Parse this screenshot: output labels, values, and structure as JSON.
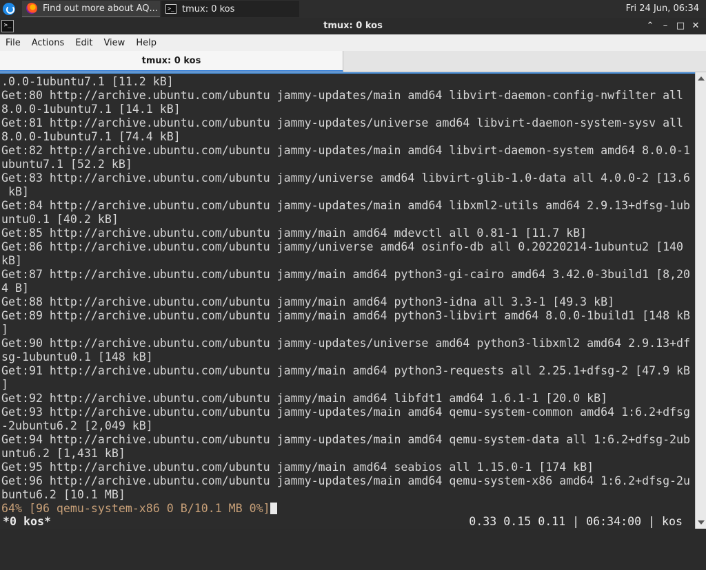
{
  "taskbar": {
    "tasks": [
      {
        "label": "Find out more about AQ...",
        "icon": "firefox-icon"
      },
      {
        "label": "tmux: 0 kos",
        "icon": "terminal-icon"
      }
    ],
    "clock": "Fri 24 Jun, 06:34"
  },
  "window": {
    "title": "tmux: 0 kos",
    "buttons": {
      "keep_above": "⌃",
      "minimize": "–",
      "maximize": "□",
      "close": "✕"
    }
  },
  "menubar": {
    "items": [
      "File",
      "Actions",
      "Edit",
      "View",
      "Help"
    ]
  },
  "tabs": [
    {
      "label": "tmux: 0 kos",
      "active": true
    }
  ],
  "terminal": {
    "lines": [
      ".0.0-1ubuntu7.1 [11.2 kB]",
      "Get:80 http://archive.ubuntu.com/ubuntu jammy-updates/main amd64 libvirt-daemon-config-nwfilter all",
      "8.0.0-1ubuntu7.1 [14.1 kB]",
      "Get:81 http://archive.ubuntu.com/ubuntu jammy-updates/universe amd64 libvirt-daemon-system-sysv all",
      "8.0.0-1ubuntu7.1 [74.4 kB]",
      "Get:82 http://archive.ubuntu.com/ubuntu jammy-updates/main amd64 libvirt-daemon-system amd64 8.0.0-1",
      "ubuntu7.1 [52.2 kB]",
      "Get:83 http://archive.ubuntu.com/ubuntu jammy/universe amd64 libvirt-glib-1.0-data all 4.0.0-2 [13.6",
      " kB]",
      "Get:84 http://archive.ubuntu.com/ubuntu jammy-updates/main amd64 libxml2-utils amd64 2.9.13+dfsg-1ub",
      "untu0.1 [40.2 kB]",
      "Get:85 http://archive.ubuntu.com/ubuntu jammy/main amd64 mdevctl all 0.81-1 [11.7 kB]",
      "Get:86 http://archive.ubuntu.com/ubuntu jammy/universe amd64 osinfo-db all 0.20220214-1ubuntu2 [140",
      "kB]",
      "Get:87 http://archive.ubuntu.com/ubuntu jammy/main amd64 python3-gi-cairo amd64 3.42.0-3build1 [8,20",
      "4 B]",
      "Get:88 http://archive.ubuntu.com/ubuntu jammy/main amd64 python3-idna all 3.3-1 [49.3 kB]",
      "Get:89 http://archive.ubuntu.com/ubuntu jammy/main amd64 python3-libvirt amd64 8.0.0-1build1 [148 kB",
      "]",
      "Get:90 http://archive.ubuntu.com/ubuntu jammy-updates/universe amd64 python3-libxml2 amd64 2.9.13+df",
      "sg-1ubuntu0.1 [148 kB]",
      "Get:91 http://archive.ubuntu.com/ubuntu jammy/main amd64 python3-requests all 2.25.1+dfsg-2 [47.9 kB",
      "]",
      "Get:92 http://archive.ubuntu.com/ubuntu jammy/main amd64 libfdt1 amd64 1.6.1-1 [20.0 kB]",
      "Get:93 http://archive.ubuntu.com/ubuntu jammy-updates/main amd64 qemu-system-common amd64 1:6.2+dfsg",
      "-2ubuntu6.2 [2,049 kB]",
      "Get:94 http://archive.ubuntu.com/ubuntu jammy-updates/main amd64 qemu-system-data all 1:6.2+dfsg-2ub",
      "untu6.2 [1,431 kB]",
      "Get:95 http://archive.ubuntu.com/ubuntu jammy/main amd64 seabios all 1.15.0-1 [174 kB]",
      "Get:96 http://archive.ubuntu.com/ubuntu jammy-updates/main amd64 qemu-system-x86 amd64 1:6.2+dfsg-2u",
      "buntu6.2 [10.1 MB]"
    ],
    "progress_line": "64% [96 qemu-system-x86 0 B/10.1 MB 0%]"
  },
  "tmux_status": {
    "window": "*0 kos*",
    "right": "0.33 0.15 0.11 | 06:34:00 | kos"
  },
  "colors": {
    "terminal_bg": "#2c2c2c",
    "terminal_fg": "#d6d6d6",
    "progress_fg": "#c8a078",
    "tab_accent": "#2f7bd6"
  }
}
